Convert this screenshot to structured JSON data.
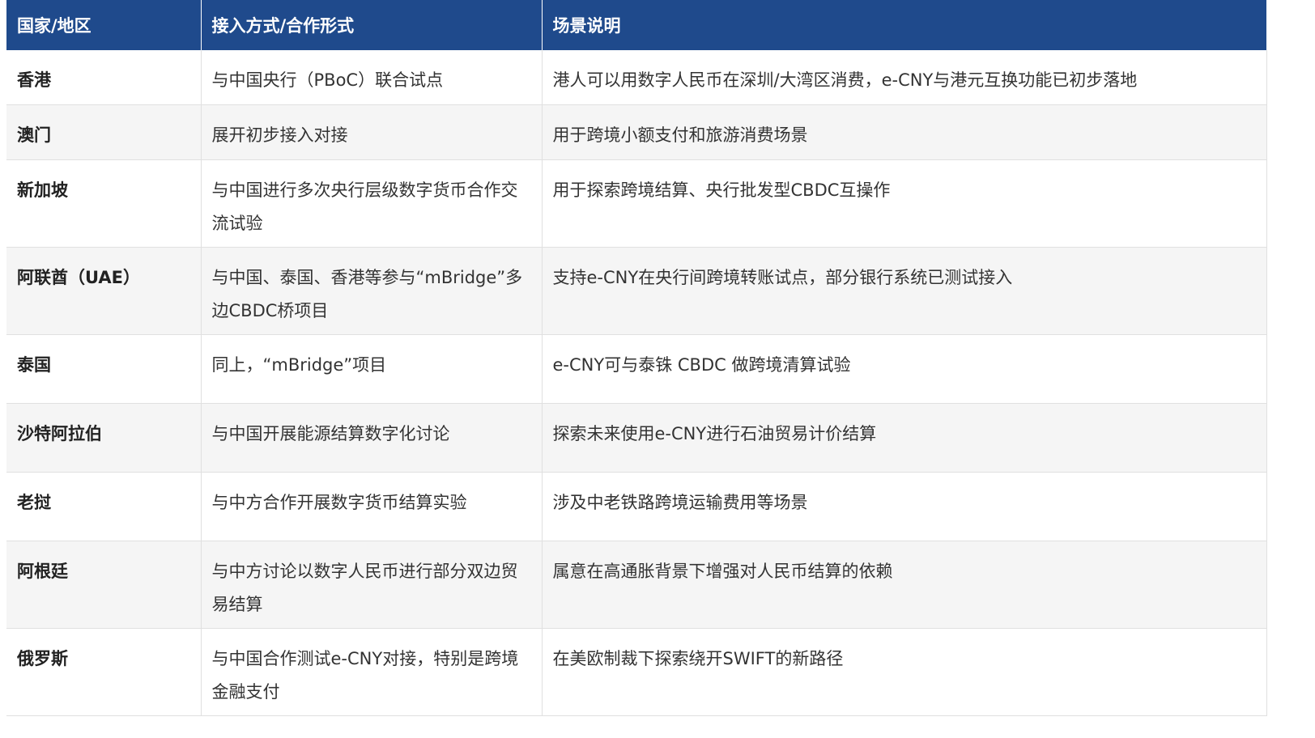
{
  "table": {
    "headers": [
      "国家/地区",
      "接入方式/合作形式",
      "场景说明"
    ],
    "rows": [
      {
        "country": "香港",
        "mode": "与中国央行（PBoC）联合试点",
        "scenario": "港人可以用数字人民币在深圳/大湾区消费，e-CNY与港元互换功能已初步落地"
      },
      {
        "country": "澳门",
        "mode": "展开初步接入对接",
        "scenario": "用于跨境小额支付和旅游消费场景"
      },
      {
        "country": "新加坡",
        "mode": "与中国进行多次央行层级数字货币合作交流试验",
        "scenario": "用于探索跨境结算、央行批发型CBDC互操作"
      },
      {
        "country": "阿联酋（UAE）",
        "mode": "与中国、泰国、香港等参与“mBridge”多边CBDC桥项目",
        "scenario": "支持e-CNY在央行间跨境转账试点，部分银行系统已测试接入"
      },
      {
        "country": "泰国",
        "mode": "同上，“mBridge”项目",
        "scenario": "e-CNY可与泰铢 CBDC 做跨境清算试验"
      },
      {
        "country": "沙特阿拉伯",
        "mode": "与中国开展能源结算数字化讨论",
        "scenario": "探索未来使用e-CNY进行石油贸易计价结算"
      },
      {
        "country": "老挝",
        "mode": "与中方合作开展数字货币结算实验",
        "scenario": "涉及中老铁路跨境运输费用等场景"
      },
      {
        "country": "阿根廷",
        "mode": "与中方讨论以数字人民币进行部分双边贸易结算",
        "scenario": "属意在高通胀背景下增强对人民币结算的依赖"
      },
      {
        "country": "俄罗斯",
        "mode": "与中国合作测试e-CNY对接，特别是跨境金融支付",
        "scenario": "在美欧制裁下探索绕开SWIFT的新路径"
      }
    ]
  },
  "colors": {
    "header_bg": "#1f4a8c",
    "header_text": "#ffffff",
    "row_alt_bg": "#f5f5f5",
    "border": "#e0e0e0"
  }
}
